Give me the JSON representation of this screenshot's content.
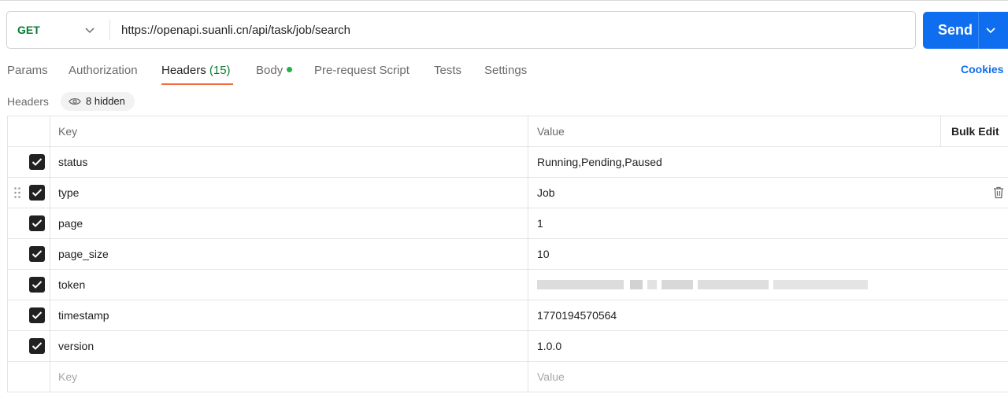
{
  "request": {
    "method": "GET",
    "url": "https://openapi.suanli.cn/api/task/job/search",
    "send_label": "Send"
  },
  "tabs": [
    {
      "label": "Params"
    },
    {
      "label": "Authorization"
    },
    {
      "label": "Headers",
      "count": "(15)",
      "active": true
    },
    {
      "label": "Body",
      "has_dot": true
    },
    {
      "label": "Pre-request Script"
    },
    {
      "label": "Tests"
    },
    {
      "label": "Settings"
    }
  ],
  "cookies_label": "Cookies",
  "headers_section": {
    "label": "Headers",
    "hidden_label": "8 hidden"
  },
  "table": {
    "columns": {
      "key": "Key",
      "value": "Value",
      "bulk_edit": "Bulk Edit"
    },
    "rows": [
      {
        "key": "status",
        "value": "Running,Pending,Paused",
        "checked": true
      },
      {
        "key": "type",
        "value": "Job",
        "checked": true
      },
      {
        "key": "page",
        "value": "1",
        "checked": true
      },
      {
        "key": "page_size",
        "value": "10",
        "checked": true
      },
      {
        "key": "token",
        "value": "",
        "checked": true,
        "redacted": true
      },
      {
        "key": "timestamp",
        "value": "1770194570564",
        "checked": true
      },
      {
        "key": "version",
        "value": "1.0.0",
        "checked": true
      }
    ],
    "new_row": {
      "key_placeholder": "Key",
      "value_placeholder": "Value"
    }
  },
  "colors": {
    "method": "#0b7a33",
    "send": "#0f6ef0",
    "active_tab_underline": "#f26b3a",
    "body_dot": "#1fb34a"
  }
}
